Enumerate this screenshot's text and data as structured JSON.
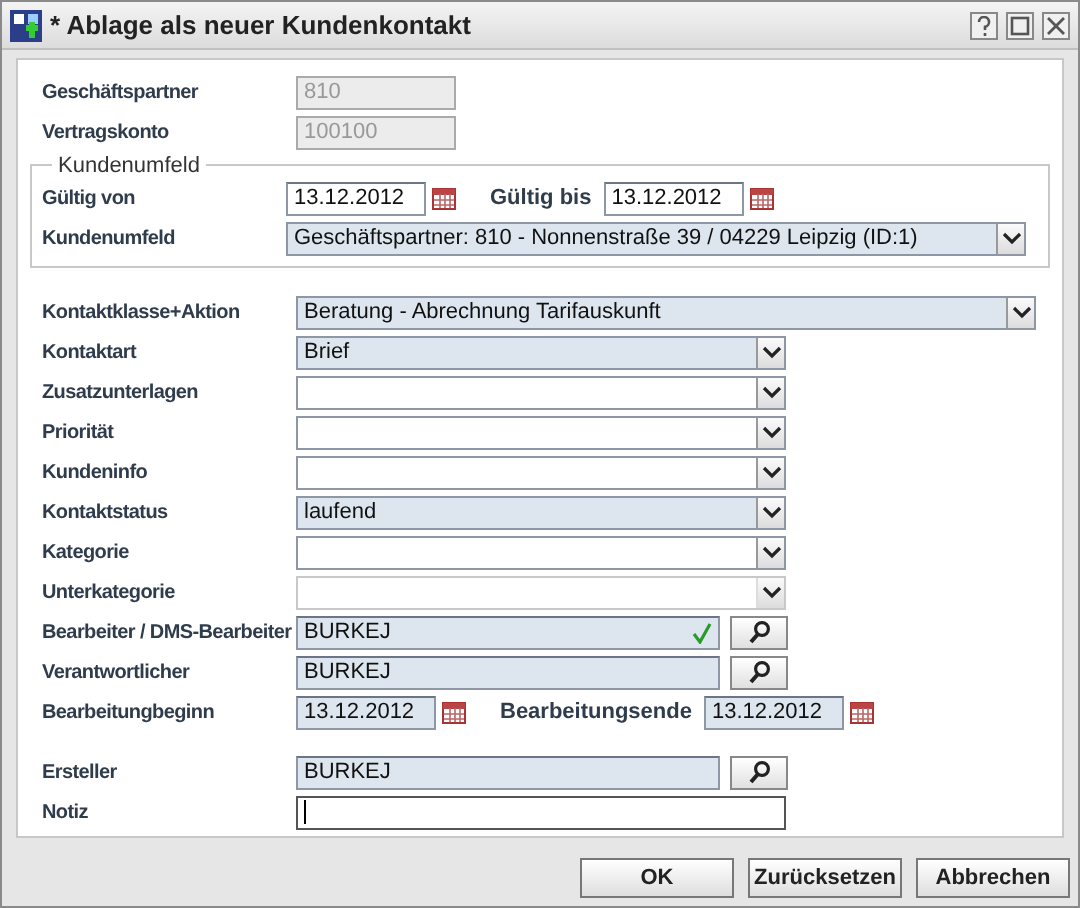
{
  "window": {
    "title": "* Ablage als neuer Kundenkontakt"
  },
  "header_fields": [
    {
      "kind": "readonly",
      "label": "Geschäftspartner",
      "value": "810",
      "disabled": true
    },
    {
      "kind": "readonly",
      "label": "Vertragskonto",
      "value": "100100",
      "disabled": true
    }
  ],
  "group": {
    "legend": "Kundenumfeld",
    "rows": [
      {
        "kind": "dates",
        "label": "Gültig von",
        "value": "13.12.2012",
        "label2": "Gültig bis",
        "value2": "13.12.2012",
        "highlighted": false
      },
      {
        "kind": "combo_wide",
        "label": "Kundenumfeld",
        "value": "Geschäftspartner: 810 - Nonnenstraße 39 / 04229 Leipzig  (ID:1)",
        "disabled": false,
        "highlighted": true
      }
    ]
  },
  "fields": [
    {
      "kind": "combo_wide",
      "label": "Kontaktklasse+Aktion",
      "value": "Beratung - Abrechnung Tarifauskunft",
      "disabled": false,
      "highlighted": true
    },
    {
      "kind": "combo",
      "label": "Kontaktart",
      "value": "Brief",
      "disabled": false,
      "highlighted": true
    },
    {
      "kind": "combo",
      "label": "Zusatzunterlagen",
      "disabled": false,
      "highlighted": false
    },
    {
      "kind": "combo",
      "label": "Priorität",
      "disabled": false,
      "highlighted": false
    },
    {
      "kind": "combo",
      "label": "Kundeninfo",
      "disabled": false,
      "highlighted": false
    },
    {
      "kind": "combo",
      "label": "Kontaktstatus",
      "value": "laufend",
      "disabled": false,
      "highlighted": true
    },
    {
      "kind": "combo",
      "label": "Kategorie",
      "disabled": false,
      "highlighted": false
    },
    {
      "kind": "combo",
      "label": "Unterkategorie",
      "disabled": true,
      "highlighted": false
    },
    {
      "kind": "lookup",
      "label": "Bearbeiter / DMS-Bearbeiter",
      "value": "BURKEJ",
      "validated": true,
      "highlighted": true
    },
    {
      "kind": "lookup",
      "label": "Verantwortlicher",
      "value": "BURKEJ",
      "validated": false,
      "highlighted": true
    },
    {
      "kind": "dates",
      "label": "Bearbeitungbeginn",
      "value": "13.12.2012",
      "label2": "Bearbeitungsende",
      "value2": "13.12.2012",
      "highlighted": true
    }
  ],
  "creator_fields": [
    {
      "kind": "lookup",
      "label": "Ersteller",
      "value": "BURKEJ",
      "validated": false,
      "highlighted": true
    },
    {
      "kind": "note",
      "label": "Notiz",
      "focused": true,
      "highlighted": false
    }
  ],
  "buttons": [
    "OK",
    "Zurücksetzen",
    "Abbrechen"
  ]
}
